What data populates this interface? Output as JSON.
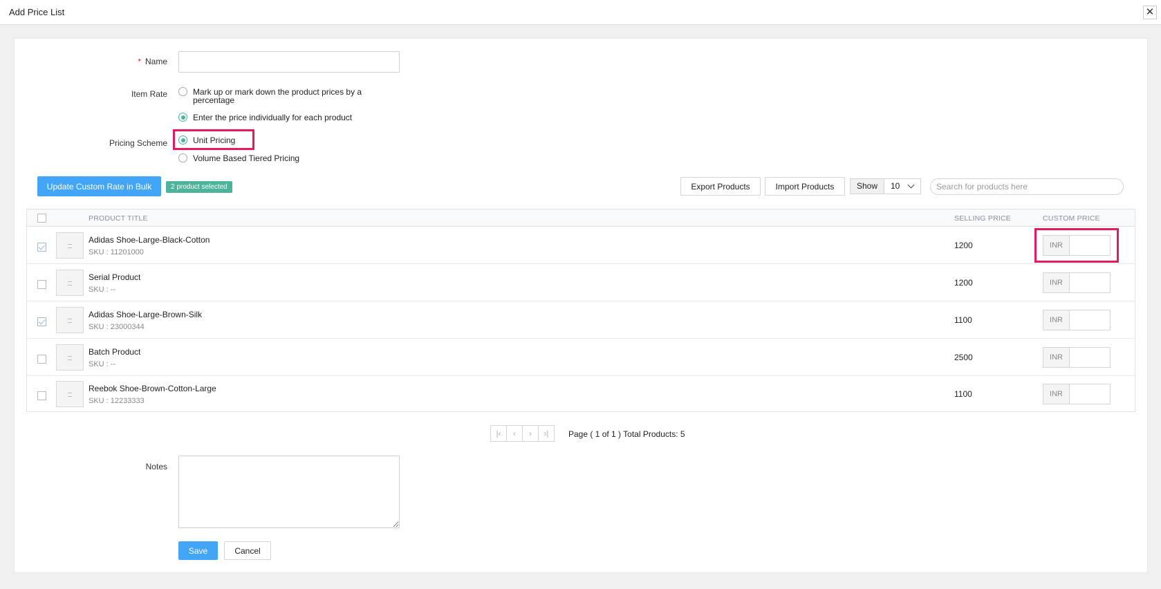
{
  "window": {
    "title": "Add Price List",
    "close_glyph": "✕"
  },
  "form": {
    "name_label": "Name",
    "name_required_mark": "*",
    "name_value": "",
    "item_rate_label": "Item Rate",
    "item_rate_options": [
      {
        "label": "Mark up or mark down the product prices by a percentage",
        "selected": false
      },
      {
        "label": "Enter the price individually for each product",
        "selected": true
      }
    ],
    "pricing_scheme_label": "Pricing Scheme",
    "pricing_scheme_options": [
      {
        "label": "Unit Pricing",
        "selected": true
      },
      {
        "label": "Volume Based Tiered Pricing",
        "selected": false
      }
    ],
    "notes_label": "Notes",
    "notes_value": ""
  },
  "toolbar": {
    "bulk_button": "Update Custom Rate in Bulk",
    "selected_badge": "2 product selected",
    "export_button": "Export Products",
    "import_button": "Import Products",
    "show_label": "Show",
    "show_value": "10",
    "search_placeholder": "Search for products here"
  },
  "table": {
    "headers": {
      "title": "PRODUCT TITLE",
      "selling": "SELLING PRICE",
      "custom": "CUSTOM PRICE"
    },
    "rows": [
      {
        "title": "Adidas Shoe-Large-Black-Cotton",
        "sku": "SKU : 11201000",
        "price": "1200",
        "currency": "INR",
        "checked": true
      },
      {
        "title": "Serial Product",
        "sku": "SKU : --",
        "price": "1200",
        "currency": "INR",
        "checked": false
      },
      {
        "title": "Adidas Shoe-Large-Brown-Silk",
        "sku": "SKU : 23000344",
        "price": "1100",
        "currency": "INR",
        "checked": true
      },
      {
        "title": "Batch Product",
        "sku": "SKU : --",
        "price": "2500",
        "currency": "INR",
        "checked": false
      },
      {
        "title": "Reebok Shoe-Brown-Cotton-Large",
        "sku": "SKU : 12233333",
        "price": "1100",
        "currency": "INR",
        "checked": false
      }
    ]
  },
  "pagination": {
    "info": "Page ( 1 of 1 ) Total Products: 5",
    "first_glyph": "|‹",
    "prev_glyph": "‹",
    "next_glyph": "›",
    "last_glyph": "›|"
  },
  "footer": {
    "save_button": "Save",
    "cancel_button": "Cancel"
  },
  "colors": {
    "accent": "#42a5f5",
    "radio_on": "#4ab39a",
    "highlight": "#e8195a",
    "badge": "#4db39a"
  }
}
